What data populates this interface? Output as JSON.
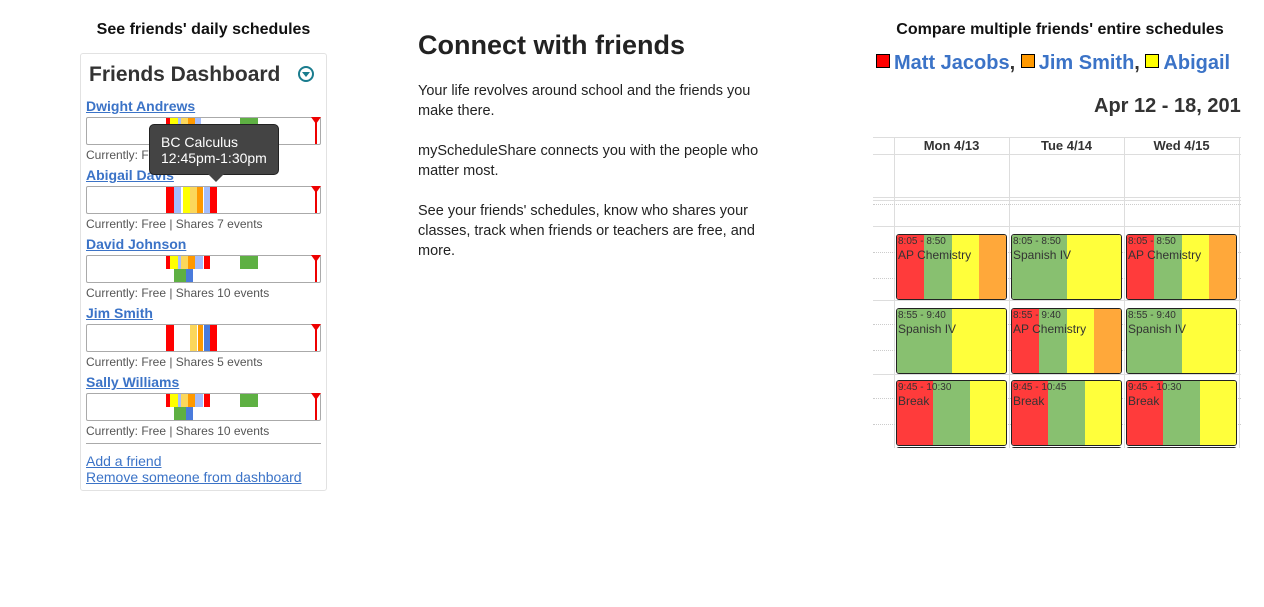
{
  "dashboard_section": {
    "heading": "See friends' daily schedules",
    "title": "Friends Dashboard",
    "toggle_icon": "chevron-down-circle-icon",
    "friends": [
      {
        "name": "Dwight Andrews",
        "status": "Currently: Free | Shares 9 events",
        "segments": [
          {
            "start": 0.34,
            "end": 0.355,
            "row": 0,
            "color": "#ff0000"
          },
          {
            "start": 0.355,
            "end": 0.39,
            "row": 0,
            "color": "#ffff00"
          },
          {
            "start": 0.39,
            "end": 0.405,
            "row": 0,
            "color": "#a4bdfc"
          },
          {
            "start": 0.405,
            "end": 0.435,
            "row": 0,
            "color": "#fbd75b"
          },
          {
            "start": 0.435,
            "end": 0.465,
            "row": 0,
            "color": "#ff9900"
          },
          {
            "start": 0.465,
            "end": 0.49,
            "row": 0,
            "color": "#a4bdfc"
          },
          {
            "start": 0.655,
            "end": 0.735,
            "row": 0,
            "color": "#5eb043"
          }
        ]
      },
      {
        "name": "Abigail Davis",
        "status": "Currently: Free | Shares 7 events",
        "segments": [
          {
            "start": 0.34,
            "end": 0.375,
            "row": -1,
            "color": "#ff0000"
          },
          {
            "start": 0.375,
            "end": 0.405,
            "row": -1,
            "color": "#a4bdfc"
          },
          {
            "start": 0.41,
            "end": 0.44,
            "row": -1,
            "color": "#ffff00"
          },
          {
            "start": 0.44,
            "end": 0.47,
            "row": -1,
            "color": "#fbd75b"
          },
          {
            "start": 0.47,
            "end": 0.5,
            "row": -1,
            "color": "#ff9900"
          },
          {
            "start": 0.5,
            "end": 0.53,
            "row": -1,
            "color": "#a4bdfc"
          },
          {
            "start": 0.53,
            "end": 0.56,
            "row": -1,
            "color": "#ff0000"
          }
        ]
      },
      {
        "name": "David Johnson",
        "status": "Currently: Free | Shares 10 events",
        "segments": [
          {
            "start": 0.34,
            "end": 0.355,
            "row": 0,
            "color": "#ff0000"
          },
          {
            "start": 0.355,
            "end": 0.39,
            "row": 0,
            "color": "#ffff00"
          },
          {
            "start": 0.39,
            "end": 0.405,
            "row": 0,
            "color": "#a4bdfc"
          },
          {
            "start": 0.405,
            "end": 0.435,
            "row": 0,
            "color": "#fbd75b"
          },
          {
            "start": 0.435,
            "end": 0.465,
            "row": 0,
            "color": "#ff9900"
          },
          {
            "start": 0.465,
            "end": 0.5,
            "row": 0,
            "color": "#a4bdfc"
          },
          {
            "start": 0.5,
            "end": 0.53,
            "row": 0,
            "color": "#ff0000"
          },
          {
            "start": 0.655,
            "end": 0.735,
            "row": 0,
            "color": "#5eb043"
          },
          {
            "start": 0.375,
            "end": 0.425,
            "row": 1,
            "color": "#5eb043"
          },
          {
            "start": 0.425,
            "end": 0.455,
            "row": 1,
            "color": "#4a7bdc"
          }
        ]
      },
      {
        "name": "Jim Smith",
        "status": "Currently: Free | Shares 5 events",
        "segments": [
          {
            "start": 0.34,
            "end": 0.375,
            "row": -1,
            "color": "#ff0000"
          },
          {
            "start": 0.44,
            "end": 0.47,
            "row": -1,
            "color": "#fbd75b"
          },
          {
            "start": 0.475,
            "end": 0.5,
            "row": -1,
            "color": "#ff9900"
          },
          {
            "start": 0.5,
            "end": 0.53,
            "row": -1,
            "color": "#4a7bdc"
          },
          {
            "start": 0.53,
            "end": 0.56,
            "row": -1,
            "color": "#ff0000"
          }
        ]
      },
      {
        "name": "Sally Williams",
        "status": "Currently: Free | Shares 10 events",
        "segments": [
          {
            "start": 0.34,
            "end": 0.355,
            "row": 0,
            "color": "#ff0000"
          },
          {
            "start": 0.355,
            "end": 0.39,
            "row": 0,
            "color": "#ffff00"
          },
          {
            "start": 0.39,
            "end": 0.405,
            "row": 0,
            "color": "#a4bdfc"
          },
          {
            "start": 0.405,
            "end": 0.435,
            "row": 0,
            "color": "#fbd75b"
          },
          {
            "start": 0.435,
            "end": 0.465,
            "row": 0,
            "color": "#ff9900"
          },
          {
            "start": 0.465,
            "end": 0.5,
            "row": 0,
            "color": "#a4bdfc"
          },
          {
            "start": 0.5,
            "end": 0.53,
            "row": 0,
            "color": "#ff0000"
          },
          {
            "start": 0.655,
            "end": 0.735,
            "row": 0,
            "color": "#5eb043"
          },
          {
            "start": 0.375,
            "end": 0.425,
            "row": 1,
            "color": "#5eb043"
          },
          {
            "start": 0.425,
            "end": 0.455,
            "row": 1,
            "color": "#4a7bdc"
          }
        ]
      }
    ],
    "tooltip": {
      "title": "BC Calculus",
      "time": "12:45pm-1:30pm"
    },
    "add_friend": "Add a friend",
    "remove_friend": "Remove someone from dashboard"
  },
  "middle": {
    "title": "Connect with friends",
    "paragraphs": [
      "Your life revolves around school and the friends you make there.",
      "myScheduleShare connects you with the people who matter most.",
      "See your friends' schedules, know who shares your classes, track when friends or teachers are free, and more."
    ]
  },
  "compare": {
    "heading": "Compare multiple friends' entire schedules",
    "legend": [
      {
        "name": "Matt Jacobs",
        "color": "#ff0000",
        "sep": ","
      },
      {
        "name": "Jim Smith",
        "color": "#ff9900",
        "sep": ","
      },
      {
        "name": "Abigail",
        "color": "#ffff00",
        "sep": ""
      }
    ],
    "date_range": "Apr 12 - 18, 201",
    "days": [
      "Mon 4/13",
      "Tue 4/14",
      "Wed 4/15"
    ],
    "colors": {
      "red": "#ff3b3b",
      "green": "#88c070",
      "yellow": "#ffff3b",
      "orange": "#ffa83a"
    },
    "events": [
      [
        {
          "time": "8:05 - 8:50",
          "title": "AP Chemistry",
          "stripes": [
            [
              "red",
              0.25
            ],
            [
              "green",
              0.25
            ],
            [
              "yellow",
              0.25
            ],
            [
              "orange",
              0.25
            ]
          ]
        },
        {
          "time": "8:55 - 9:40",
          "title": "Spanish IV",
          "stripes": [
            [
              "green",
              0.5
            ],
            [
              "yellow",
              0.5
            ]
          ]
        },
        {
          "time": "9:45 - 10:30",
          "title": "Break",
          "stripes": [
            [
              "red",
              0.333
            ],
            [
              "green",
              0.333
            ],
            [
              "yellow",
              0.334
            ]
          ]
        }
      ],
      [
        {
          "time": "8:05 - 8:50",
          "title": "Spanish IV",
          "stripes": [
            [
              "green",
              0.5
            ],
            [
              "yellow",
              0.5
            ]
          ]
        },
        {
          "time": "8:55 - 9:40",
          "title": "AP Chemistry",
          "stripes": [
            [
              "red",
              0.25
            ],
            [
              "green",
              0.25
            ],
            [
              "yellow",
              0.25
            ],
            [
              "orange",
              0.25
            ]
          ]
        },
        {
          "time": "9:45 - 10:45",
          "title": "Break",
          "stripes": [
            [
              "red",
              0.333
            ],
            [
              "green",
              0.333
            ],
            [
              "yellow",
              0.334
            ]
          ]
        }
      ],
      [
        {
          "time": "8:05 - 8:50",
          "title": "AP Chemistry",
          "stripes": [
            [
              "red",
              0.25
            ],
            [
              "green",
              0.25
            ],
            [
              "yellow",
              0.25
            ],
            [
              "orange",
              0.25
            ]
          ]
        },
        {
          "time": "8:55 - 9:40",
          "title": "Spanish IV",
          "stripes": [
            [
              "green",
              0.5
            ],
            [
              "yellow",
              0.5
            ]
          ]
        },
        {
          "time": "9:45 - 10:30",
          "title": "Break",
          "stripes": [
            [
              "red",
              0.333
            ],
            [
              "green",
              0.333
            ],
            [
              "yellow",
              0.334
            ]
          ]
        }
      ]
    ]
  }
}
